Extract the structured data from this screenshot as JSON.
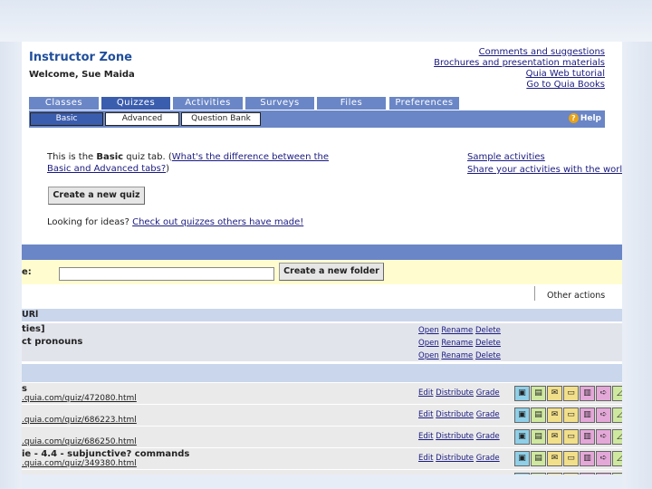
{
  "header": {
    "title": "Instructor Zone",
    "welcome": "Welcome, Sue Maida",
    "links": [
      "Comments and suggestions",
      "Brochures and presentation materials",
      "Quia Web tutorial",
      "Go to Quia Books"
    ]
  },
  "tabs": [
    {
      "label": "Classes",
      "active": false
    },
    {
      "label": "Quizzes",
      "active": true
    },
    {
      "label": "Activities",
      "active": false
    },
    {
      "label": "Surveys",
      "active": false
    },
    {
      "label": "Files",
      "active": false
    },
    {
      "label": "Preferences",
      "active": false
    }
  ],
  "subtabs": [
    {
      "label": "Basic",
      "active": true
    },
    {
      "label": "Advanced",
      "active": false
    },
    {
      "label": "Question Bank",
      "active": false
    }
  ],
  "help_label": "Help",
  "help_glyph": "?",
  "intro": {
    "before": "This is the ",
    "bold": "Basic",
    "after": " quiz tab. (",
    "link1": "What's the difference between the",
    "link2": "Basic and Advanced tabs?",
    "end": ")"
  },
  "samples": {
    "link1": "Sample activities",
    "link2": "Share your activities with the world"
  },
  "create_quiz_button": "Create a new quiz",
  "ideas": {
    "text": "Looking for ideas? ",
    "link": "Check out quizzes others have made!"
  },
  "folder_label": "e:",
  "create_folder_button": "Create a new folder",
  "other_actions": "Other actions",
  "url_header": "URl",
  "folders": [
    {
      "name": "ties]",
      "actions": [
        "Open",
        "Rename",
        "Delete"
      ]
    },
    {
      "name": "ct pronouns",
      "actions": [
        "Open",
        "Rename",
        "Delete"
      ]
    },
    {
      "name": "",
      "actions": [
        "Open",
        "Rename",
        "Delete"
      ]
    }
  ],
  "quizzes": [
    {
      "title": "s",
      "url": ".quia.com/quiz/472080.html",
      "actions": [
        "Edit",
        "Distribute",
        "Grade"
      ]
    },
    {
      "title": "",
      "url": ".quia.com/quiz/686223.html",
      "actions": [
        "Edit",
        "Distribute",
        "Grade"
      ]
    },
    {
      "title": "",
      "url": ".quia.com/quiz/686250.html",
      "actions": [
        "Edit",
        "Distribute",
        "Grade"
      ]
    },
    {
      "title": "ie - 4.4 - subjunctive? commands",
      "url": ".quia.com/quiz/349380.html",
      "actions": [
        "Edit",
        "Distribute",
        "Grade"
      ]
    },
    {
      "title": "",
      "url": "",
      "actions": []
    }
  ],
  "icon_set": [
    {
      "name": "monitor-icon",
      "glyph": "▣",
      "color": "#8fd0e8"
    },
    {
      "name": "document-icon",
      "glyph": "▤",
      "color": "#cfe8a0"
    },
    {
      "name": "envelope-icon",
      "glyph": "✉",
      "color": "#f2df8a"
    },
    {
      "name": "edit-icon",
      "glyph": "▭",
      "color": "#f2df8a"
    },
    {
      "name": "print-icon",
      "glyph": "▥",
      "color": "#e4a8d8"
    },
    {
      "name": "export-icon",
      "glyph": "➪",
      "color": "#e4a8d8"
    },
    {
      "name": "chart-icon",
      "glyph": "◿",
      "color": "#cfe8a0"
    }
  ]
}
